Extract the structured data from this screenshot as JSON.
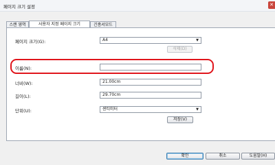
{
  "window": {
    "title": "페이지 크기 설정",
    "close_glyph": "✕"
  },
  "tabs": [
    {
      "label": "스캔 영역"
    },
    {
      "label": "사용자 지정 페이지 크기"
    },
    {
      "label": "긴종서모드"
    }
  ],
  "form": {
    "page_size": {
      "label": "페이지 크기(G):",
      "value": "A4"
    },
    "delete_button": "삭제(D)",
    "name": {
      "label": "이름(N):",
      "value": ""
    },
    "width": {
      "label": "너비(W):",
      "value": "21.00cm"
    },
    "length": {
      "label": "길이(L):",
      "value": "29.70cm"
    },
    "unit": {
      "label": "단위(U):",
      "value": "센티미터"
    },
    "save_button": "저장(V)"
  },
  "footer": {
    "ok": "확인",
    "cancel": "취소",
    "help": "도움말(H)"
  },
  "icons": {
    "dropdown": "▼"
  },
  "colors": {
    "highlight": "#e0141b",
    "default_button_border": "#3c7fb1"
  }
}
